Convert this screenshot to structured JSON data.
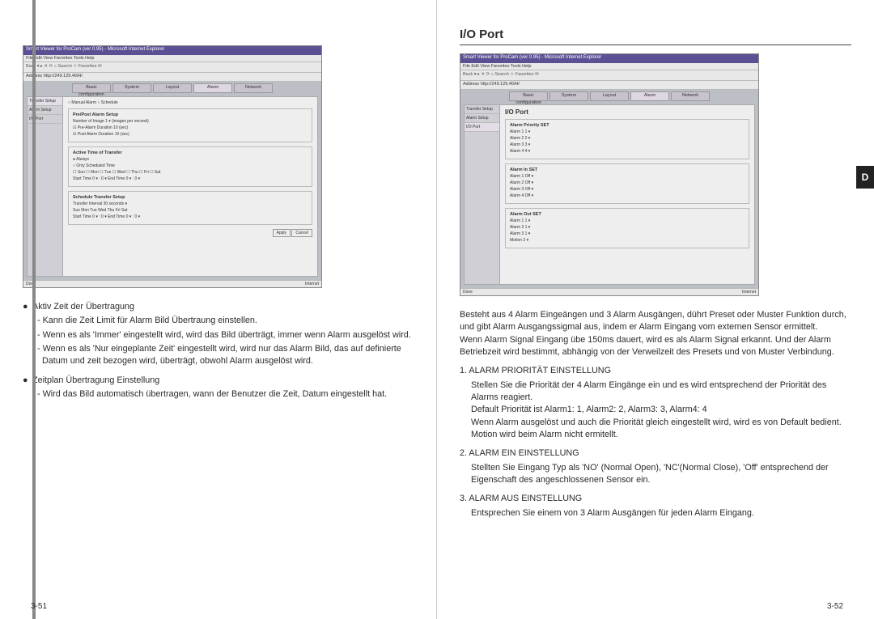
{
  "sideTab": "D",
  "left": {
    "pageNum": "3-51",
    "screenshot": {
      "title": "Smart Viewer for ProCam (ver 0.95) - Microsoft Internet Explorer",
      "menu": "File  Edit  View  Favorites  Tools  Help",
      "toolbar": "Back  ▾   ▸   ✕   ⟳   ⌂   Search  ☆ Favorites   ✉",
      "address": "Address  http://249.129.40/H/",
      "tabs": [
        "Basic configuration",
        "System",
        "Layout",
        "Alarm",
        "Network"
      ],
      "activeTab": 3,
      "sideNav": [
        "Transfer Setup",
        "Alarm Setup",
        "I/O Port"
      ],
      "sideNavActive": 0,
      "panelHeader": "○ Manual Alarm    ○ Schedule",
      "fs1": {
        "legend": "Pre/Post Alarm Setup",
        "rows": [
          "Number of Image   1 ▾  (images per second)",
          "☑ Pre-Alarm Duration   10  (sec)",
          "☑ Post Alarm Duration   10  (sec)"
        ]
      },
      "fs2": {
        "legend": "Active Time of Transfer",
        "rows": [
          "● Always",
          "○ Only Scheduled Time",
          "☐ Sun  ☐ Mon  ☐ Tue  ☐ Wed  ☐ Thu  ☐ Fri  ☐ Sat",
          "Start Time  0 ▾ : 0 ▾   End Time  0 ▾ : 0 ▾"
        ]
      },
      "fs3": {
        "legend": "Schedule Transfer Setup",
        "rows": [
          "Transfer Interval   30   seconds ▾",
          "Sun   Mon   Tue   Wed  Thu   Fri   Sat",
          "Start Time  0 ▾ : 0 ▾   End Time  0 ▾ : 0 ▾"
        ]
      },
      "buttons": [
        "Apply",
        "Cancel"
      ],
      "statusL": "Done",
      "statusR": "Internet"
    },
    "bullets": [
      {
        "head": "Aktiv Zeit der Übertragung",
        "lines": [
          "- Kann die Zeit Limit für Alarm Bild Übertraung einstellen.",
          "- Wenn es als 'Immer' eingestellt wird, wird das Bild überträgt, immer wenn Alarm ausgelöst wird.",
          "- Wenn es als 'Nur eingeplante Zeit' eingestellt wird, wird nur das Alarm Bild, das auf definierte Datum und zeit bezogen wird, überträgt, obwohl Alarm ausgelöst wird."
        ]
      },
      {
        "head": "Zeitplan Übertragung Einstellung",
        "lines": [
          "- Wird das Bild automatisch übertragen, wann der Benutzer die Zeit, Datum eingestellt hat."
        ]
      }
    ]
  },
  "right": {
    "pageNum": "3-52",
    "title": "I/O Port",
    "screenshot": {
      "title": "Smart Viewer for ProCam (ver 0.95) - Microsoft Internet Explorer",
      "menu": "File  Edit  View  Favorites  Tools  Help",
      "toolbar": "Back  ▾   ▸   ✕   ⟳   ⌂   Search  ☆ Favorites   ✉",
      "address": "Address  http://249.129.40/H/",
      "tabs": [
        "Basic configuration",
        "System",
        "Layout",
        "Alarm",
        "Network"
      ],
      "activeTab": 3,
      "sideNav": [
        "Transfer Setup",
        "Alarm Setup",
        "I/O Port"
      ],
      "sideNavActive": 2,
      "panelTitle": "I/O Port",
      "fs1": {
        "legend": "Alarm Priority SET",
        "rows": [
          "Alarm 1   1 ▾",
          "Alarm 2   2 ▾",
          "Alarm 3   3 ▾",
          "Alarm 4   4 ▾"
        ]
      },
      "fs2": {
        "legend": "Alarm In SET",
        "rows": [
          "Alarm 1   Off ▾",
          "Alarm 2   Off ▾",
          "Alarm 3   Off ▾",
          "Alarm 4   Off ▾"
        ]
      },
      "fs3": {
        "legend": "Alarm Out SET",
        "rows": [
          "Alarm 1   1 ▾",
          "Alarm 2   1 ▾",
          "Alarm 3   1 ▾",
          "Motion   2 ▾"
        ]
      },
      "statusL": "Done",
      "statusR": "Internet"
    },
    "intro": "Besteht aus 4 Alarm Eingeängen und 3 Alarm Ausgängen, dührt Preset oder Muster Funktion durch, und gibt Alarm Ausgangssigmal aus, indem er Alarm Eingang vom externen Sensor ermittelt.\nWenn Alarm Signal Eingang übe 150ms dauert, wird es als Alarm Signal erkannt. Und der Alarm Betriebzeit wird bestimmt, abhängig von der Verweilzeit des Presets und von Muster Verbindung.",
    "numbered": [
      {
        "head": "1. ALARM PRIORITÄT EINSTELLUNG",
        "body": "Stellen Sie die Priorität der 4 Alarm Eingänge ein und es wird entsprechend der Priorität des Alarms reagiert.\nDefault Priorität ist Alarm1: 1, Alarm2: 2, Alarm3: 3, Alarm4: 4\nWenn Alarm ausgelöst und auch die Priorität gleich eingestellt wird, wird es von Default bedient. Motion wird beim Alarm nicht ermitellt."
      },
      {
        "head": "2. ALARM EIN EINSTELLUNG",
        "body": "Stellten Sie Eingang Typ als 'NO' (Normal Open), 'NC'(Normal Close), 'Off' entsprechend der Eigenschaft des angeschlossenen Sensor ein."
      },
      {
        "head": "3. ALARM AUS EINSTELLUNG",
        "body": "Entsprechen Sie einem von 3 Alarm Ausgängen für jeden Alarm Eingang."
      }
    ]
  }
}
